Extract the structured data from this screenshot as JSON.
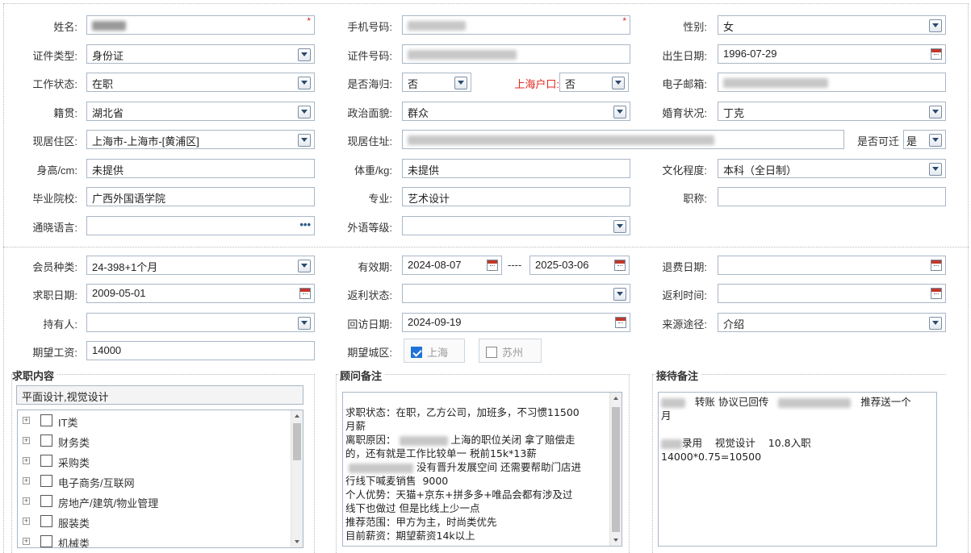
{
  "form": {
    "name": {
      "label": "姓名:"
    },
    "mobile": {
      "label": "手机号码:"
    },
    "gender": {
      "label": "性别:",
      "value": "女"
    },
    "id_type": {
      "label": "证件类型:",
      "value": "身份证"
    },
    "id_number": {
      "label": "证件号码:"
    },
    "birthdate": {
      "label": "出生日期:",
      "value": "1996-07-29"
    },
    "work_status": {
      "label": "工作状态:",
      "value": "在职"
    },
    "overseas": {
      "label": "是否海归:",
      "value": "否"
    },
    "sh_hukou": {
      "label": "上海户口:",
      "value": "否"
    },
    "email": {
      "label": "电子邮箱:"
    },
    "native": {
      "label": "籍贯:",
      "value": "湖北省"
    },
    "political": {
      "label": "政治面貌:",
      "value": "群众"
    },
    "marital": {
      "label": "婚育状况:",
      "value": "丁克"
    },
    "residence_area": {
      "label": "现居住区:",
      "value": "上海市-上海市-[黄浦区]"
    },
    "address": {
      "label": "现居住址:"
    },
    "relocate": {
      "label": "是否可迁",
      "value": "是"
    },
    "height": {
      "label": "身高/cm:",
      "value": "未提供"
    },
    "weight": {
      "label": "体重/kg:",
      "value": "未提供"
    },
    "education": {
      "label": "文化程度:",
      "value": "本科（全日制）"
    },
    "school": {
      "label": "毕业院校:",
      "value": "广西外国语学院"
    },
    "major": {
      "label": "专业:",
      "value": "艺术设计"
    },
    "title": {
      "label": "职称:",
      "value": ""
    },
    "languages": {
      "label": "通晓语言:",
      "value": ""
    },
    "lang_level": {
      "label": "外语等级:",
      "value": ""
    },
    "member_type": {
      "label": "会员种类:",
      "value": "24-398+1个月"
    },
    "validity": {
      "label": "有效期:",
      "start": "2024-08-07",
      "sep": "----",
      "end": "2025-03-06"
    },
    "refund_date": {
      "label": "退费日期:",
      "value": ""
    },
    "job_date": {
      "label": "求职日期:",
      "value": "2009-05-01"
    },
    "rebate_status": {
      "label": "返利状态:",
      "value": ""
    },
    "rebate_time": {
      "label": "返利时间:",
      "value": ""
    },
    "holder": {
      "label": "持有人:",
      "value": ""
    },
    "revisit_date": {
      "label": "回访日期:",
      "value": "2024-09-19"
    },
    "source": {
      "label": "来源途径:",
      "value": "介绍"
    },
    "salary": {
      "label": "期望工资:",
      "value": "14000"
    },
    "city": {
      "label": "期望城区:",
      "options": [
        {
          "label": "上海",
          "checked": true
        },
        {
          "label": "苏州",
          "checked": false
        }
      ]
    }
  },
  "job_panel": {
    "title": "求职内容",
    "selected": "平面设计,视觉设计",
    "categories": [
      "IT类",
      "财务类",
      "采购类",
      "电子商务/互联网",
      "房地产/建筑/物业管理",
      "服装类",
      "机械类"
    ]
  },
  "advisor_panel": {
    "title": "顾问备注",
    "lines": [
      {
        "pre": "求职状态：在职，乙方公司，加班多，不习惯11500"
      },
      {
        "pre": "月薪"
      },
      {
        "pre": "离职原因：",
        "blur": 60,
        "post": "上海的职位关闭 拿了赔偿走"
      },
      {
        "pre": "的，还有就是工作比较单一 税前15k*13薪"
      },
      {
        "pre": "",
        "blur": 80,
        "post": "没有晋升发展空间 还需要帮助门店进"
      },
      {
        "pre": "行线下喊麦销售  9000"
      },
      {
        "pre": "个人优势：天猫+京东+拼多多+唯品会都有涉及过"
      },
      {
        "pre": "线下也做过 但是比线上少一点"
      },
      {
        "pre": "推荐范围：甲方为主，时尚类优先"
      },
      {
        "pre": "目前薪资：期望薪资14k以上"
      }
    ]
  },
  "reception_panel": {
    "title": "接待备注",
    "l1a": "转账 协议已回传",
    "l1b": "推荐送一个",
    "l2": "月",
    "l3a": "录用    视觉设计    10.8入职",
    "l4": "14000*0.75=10500"
  }
}
